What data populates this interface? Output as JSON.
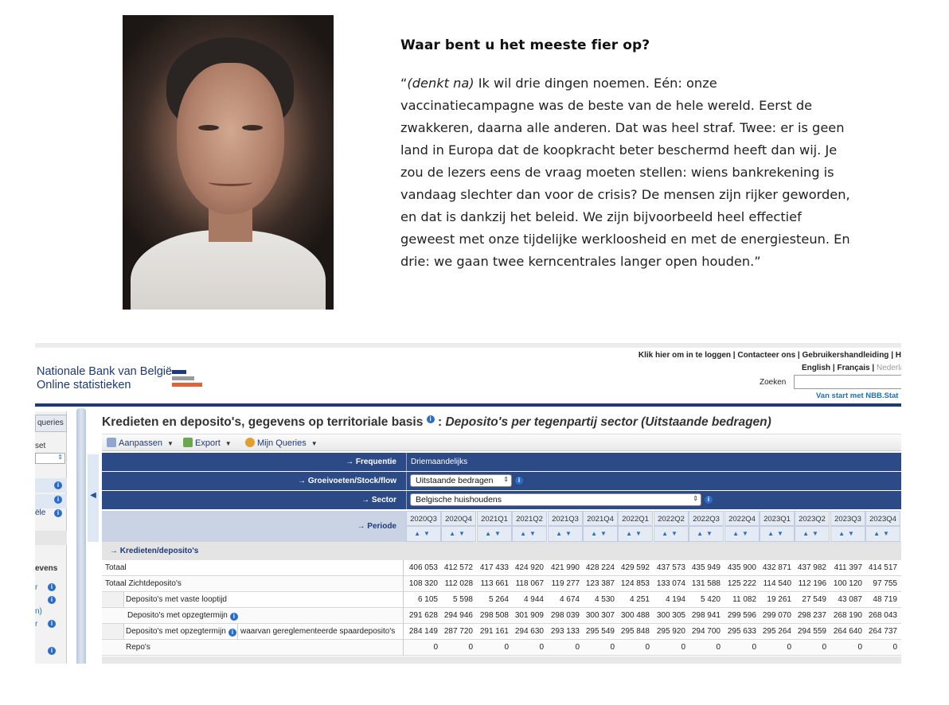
{
  "article": {
    "heading": "Waar bent u het meeste fier op?",
    "quote_open": "“",
    "quote_aside": "(denkt na)",
    "quote_body": " Ik wil drie dingen noemen. Eén: onze vaccinatiecampagne was de beste van de hele wereld. Eerst de zwakkeren, daarna alle anderen. Dat was heel straf. Twee: er is geen land in Europa dat de koopkracht beter beschermd heeft dan wij. Je zou de lezers eens de vraag moeten stellen: wiens bankrekening is vandaag slechter dan voor de crisis? De mensen zijn rijker geworden, en dat is dankzij het beleid. We zijn bijvoorbeeld heel effectief geweest met onze tijdelijke werkloosheid en met de energiesteun. En drie: we gaan twee kerncentrales langer open houden.”"
  },
  "nbb": {
    "top_links": "Klik hier om in te loggen | Contacteer ons | Gebruikershandleiding | H",
    "lang_english": "English",
    "lang_sep1": " | ",
    "lang_francais": "Français",
    "lang_sep2": " | ",
    "lang_nederlands": "Nederla",
    "brand_line1": "Nationale Bank van België",
    "brand_line2": "Online statistieken",
    "logo_colors": [
      "#1e3a7b",
      "#9a9a9a",
      "#e0623a"
    ],
    "search_label": "Zoeken",
    "search_value": "",
    "start_link": "Van start met NBB.Stat",
    "sidebar": {
      "tab": "queries",
      "set_label": "set",
      "item_ele": "ële",
      "item_evens": "evens",
      "item_r1": "r",
      "item_n": "n)",
      "item_r2": "r"
    },
    "title_main": "Kredieten en deposito's, gegevens op territoriale basis",
    "title_sep": " : ",
    "title_sub": "Deposito's per tegenpartij sector (Uitstaande bedragen)",
    "info_glyph": "i",
    "toolbar": {
      "aanpassen": "Aanpassen",
      "export": "Export",
      "mijn_queries": "Mijn Queries",
      "caret": "▼"
    },
    "dimensions": {
      "frequentie_label": "→ Frequentie",
      "frequentie_value": "Driemaandelijks",
      "groeivoeten_label": "→ Groeivoeten/Stock/flow",
      "groeivoeten_value": "Uitstaande bedragen",
      "sector_label": "→ Sector",
      "sector_value": "Belgische huishoudens",
      "periode_label": "→ Periode",
      "select_arrow": "⇕"
    },
    "sort_glyph": "▲▼",
    "periods": [
      "2020Q3",
      "2020Q4",
      "2021Q1",
      "2021Q2",
      "2021Q3",
      "2021Q4",
      "2022Q1",
      "2022Q2",
      "2022Q3",
      "2022Q4",
      "2023Q1",
      "2023Q2",
      "2023Q3",
      "2023Q4"
    ],
    "group_label": "→ Kredieten/deposito's",
    "rows": [
      {
        "label": "Totaal",
        "values": [
          "406 053",
          "412 572",
          "417 433",
          "424 920",
          "421 990",
          "428 224",
          "429 592",
          "437 573",
          "435 949",
          "435 900",
          "432 871",
          "437 982",
          "411 397",
          "414 517"
        ]
      },
      {
        "label": "Totaal Zichtdeposito's",
        "values": [
          "108 320",
          "112 028",
          "113 661",
          "118 067",
          "119 277",
          "123 387",
          "124 853",
          "133 074",
          "131 588",
          "125 222",
          "114 540",
          "112 196",
          "100 120",
          "97 755"
        ]
      },
      {
        "label": "Deposito's met vaste looptijd",
        "values": [
          "6 105",
          "5 598",
          "5 264",
          "4 944",
          "4 674",
          "4 530",
          "4 251",
          "4 194",
          "5 420",
          "11 082",
          "19 261",
          "27 549",
          "43 087",
          "48 719"
        ]
      },
      {
        "label": "Deposito's met opzegtermijn",
        "values": [
          "291 628",
          "294 946",
          "298 508",
          "301 909",
          "298 039",
          "300 307",
          "300 488",
          "300 305",
          "298 941",
          "299 596",
          "299 070",
          "298 237",
          "268 190",
          "268 043"
        ]
      },
      {
        "label": "Deposito's met opzegtermijn",
        "sublabel": "waarvan gereglementeerde spaardeposito's",
        "values": [
          "284 149",
          "287 720",
          "291 161",
          "294 630",
          "293 133",
          "295 549",
          "295 848",
          "295 920",
          "294 700",
          "295 633",
          "295 264",
          "294 559",
          "264 640",
          "264 737"
        ]
      },
      {
        "label": "Repo's",
        "values": [
          "0",
          "0",
          "0",
          "0",
          "0",
          "0",
          "0",
          "0",
          "0",
          "0",
          "0",
          "0",
          "0",
          "0"
        ]
      }
    ]
  }
}
